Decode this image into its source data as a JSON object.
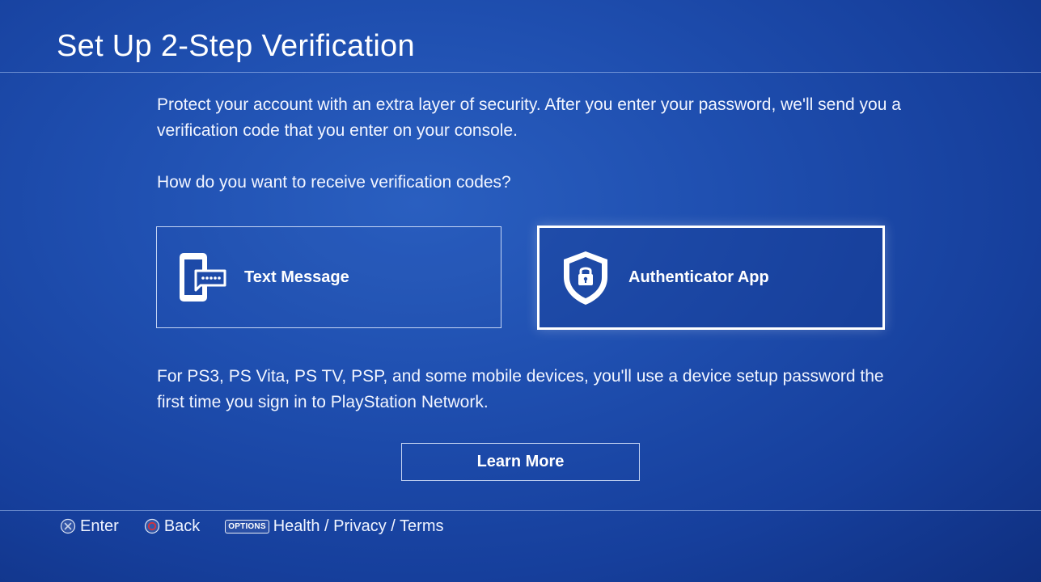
{
  "header": {
    "title": "Set Up 2-Step Verification"
  },
  "main": {
    "intro": "Protect your account with an extra layer of security. After you enter your password, we'll send you a verification code that you enter on your console.",
    "question": "How do you want to receive verification codes?",
    "options": [
      {
        "label": "Text Message",
        "icon": "phone-message-icon"
      },
      {
        "label": "Authenticator App",
        "icon": "shield-lock-icon",
        "selected": true
      }
    ],
    "note": "For PS3, PS Vita, PS TV, PSP, and some mobile devices, you'll use a device setup password the first time you sign in to PlayStation Network.",
    "learn_more_label": "Learn More"
  },
  "footer": {
    "enter_label": "Enter",
    "enter_icon": "cross-button-icon",
    "back_label": "Back",
    "back_icon": "circle-button-icon",
    "options_badge": "OPTIONS",
    "options_label": "Health / Privacy / Terms"
  },
  "colors": {
    "background": "#1f4fb0",
    "text": "#ffffff",
    "circle_button": "#d8323a"
  }
}
